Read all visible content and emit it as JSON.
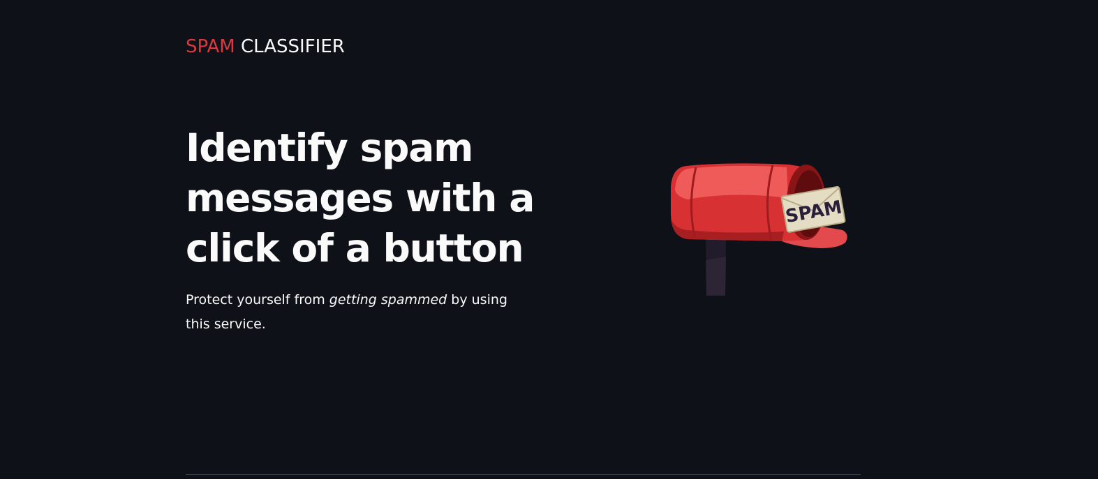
{
  "header": {
    "logo_word_1": "SPAM",
    "logo_word_2": "CLASSIFIER",
    "logo_accent_color": "#d9393f"
  },
  "hero": {
    "title": "Identify spam messages with a click of a button",
    "subtitle_before": "Protect yourself from ",
    "subtitle_emphasis": "getting spammed",
    "subtitle_after": " by using this service.",
    "illustration": {
      "icon": "mailbox-icon",
      "envelope_label": "SPAM"
    }
  },
  "theme": {
    "background": "#0e1117",
    "text": "#fafafa"
  }
}
